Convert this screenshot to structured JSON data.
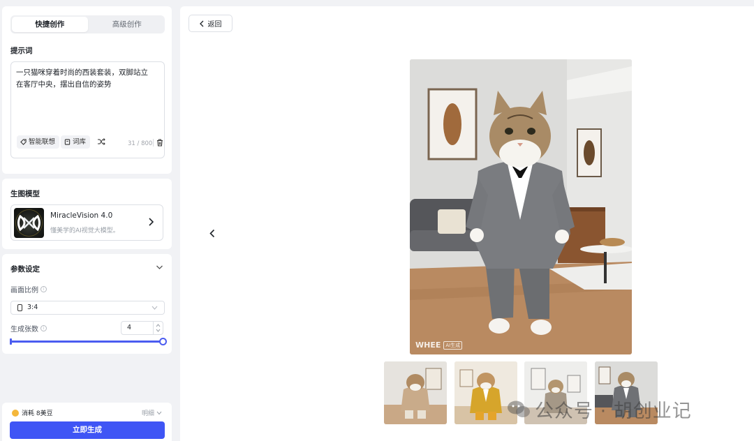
{
  "tabs": {
    "quick": "快捷创作",
    "advanced": "高级创作"
  },
  "prompt": {
    "label": "提示词",
    "text": "一只猫咪穿着时尚的西装套装，双脚站立在客厅中央，摆出自信的姿势",
    "chip_smart": "智能联想",
    "chip_lexicon": "词库",
    "counter": "31 / 800"
  },
  "model": {
    "label": "生图模型",
    "name": "MiracleVision 4.0",
    "desc": "懂美学的AI视觉大模型。"
  },
  "params": {
    "label": "参数设定",
    "ratio_label": "画面比例",
    "ratio_value": "3:4",
    "count_label": "生成张数",
    "count_value": "4",
    "count_fraction": 1.0
  },
  "footer": {
    "cost": "消耗 8美豆",
    "detail": "明细",
    "generate": "立即生成"
  },
  "main": {
    "back": "返回",
    "watermark_brand": "WHEE",
    "watermark_tag": "AI生成",
    "thumbnails": [
      "thumb-1",
      "thumb-2",
      "thumb-3",
      "thumb-4"
    ],
    "overlay_text": "公众号 · 胡创业记"
  },
  "colors": {
    "accent": "#3f55f5",
    "slider": "#4b5cf0",
    "bg": "#f1f2f5"
  }
}
